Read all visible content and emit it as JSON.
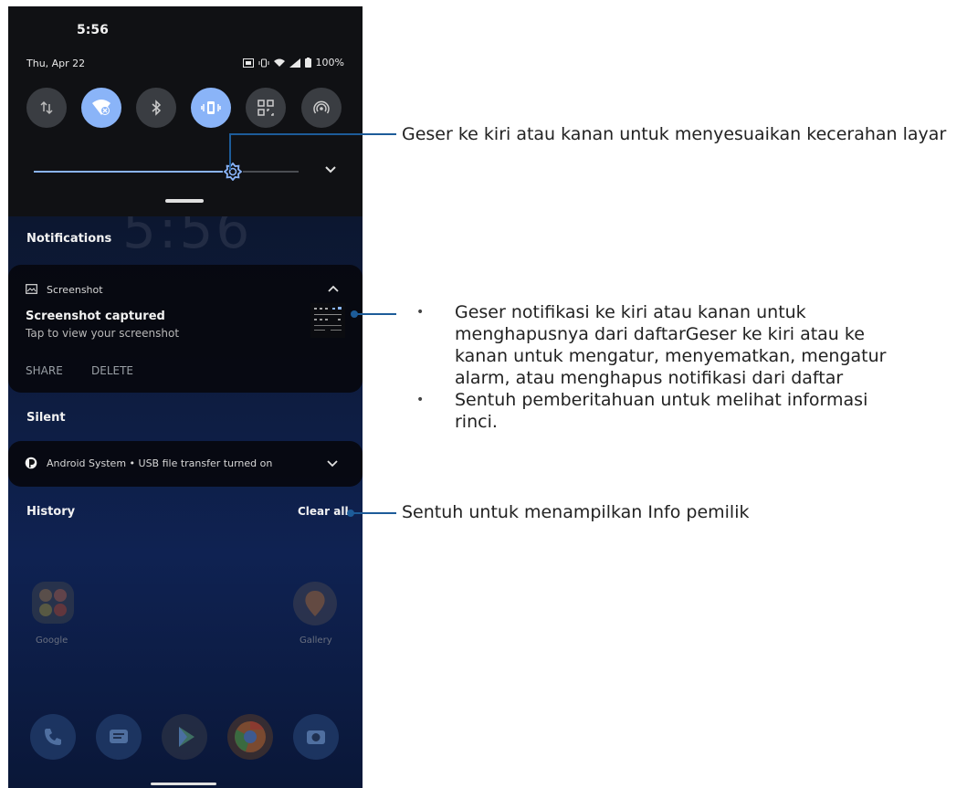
{
  "status_bar": {
    "time": "5:56",
    "date": "Thu, Apr 22",
    "battery": "100%"
  },
  "quick_settings": {
    "tiles": [
      {
        "icon": "data-transfer-icon",
        "state": "off"
      },
      {
        "icon": "wifi-off-icon",
        "state": "on"
      },
      {
        "icon": "bluetooth-icon",
        "state": "off"
      },
      {
        "icon": "vibrate-icon",
        "state": "on"
      },
      {
        "icon": "qr-scan-icon",
        "state": "off"
      },
      {
        "icon": "hotspot-icon",
        "state": "off"
      }
    ],
    "brightness_level": 0.75
  },
  "lockscreen_clock": "5:56",
  "notifications": {
    "section_label": "Notifications",
    "screenshot": {
      "app": "Screenshot",
      "title": "Screenshot captured",
      "body": "Tap to view your screenshot",
      "actions": [
        "SHARE",
        "DELETE"
      ]
    }
  },
  "silent": {
    "section_label": "Silent",
    "item_text": "Android System • USB file transfer turned on"
  },
  "history": {
    "label": "History",
    "clear_all": "Clear all"
  },
  "home": {
    "folder_label": "Google",
    "gallery_label": "Gallery"
  },
  "callouts": {
    "brightness": "Geser ke kiri atau kanan untuk menyesuaikan kecerahan layar",
    "notification_bullets": [
      "Geser notifikasi ke kiri atau kanan untuk menghapusnya dari daftarGeser ke kiri atau ke kanan untuk mengatur, menyematkan, mengatur alarm, atau menghapus notifikasi dari daftar",
      "Sentuh pemberitahuan untuk melihat informasi rinci."
    ],
    "clear_all": "Sentuh untuk menampilkan Info pemilik"
  },
  "colors": {
    "accent": "#8ab4f8",
    "callout_line": "#1d5c99"
  }
}
